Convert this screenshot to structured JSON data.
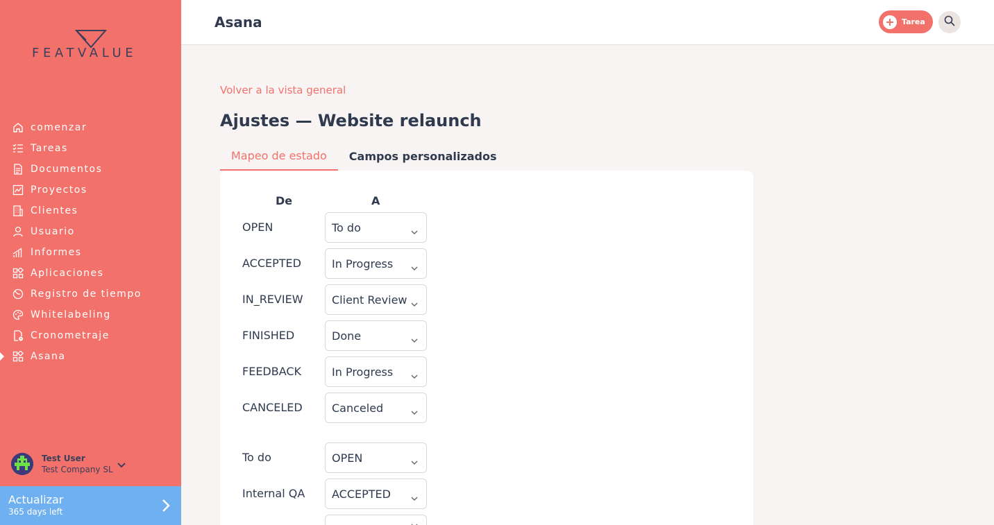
{
  "sidebar": {
    "logo_text": "FEATVALUE",
    "items": [
      {
        "label": "comenzar",
        "icon": "home-icon"
      },
      {
        "label": "Tareas",
        "icon": "checklist-icon"
      },
      {
        "label": "Documentos",
        "icon": "document-icon"
      },
      {
        "label": "Proyectos",
        "icon": "chart-icon"
      },
      {
        "label": "Clientes",
        "icon": "building-icon"
      },
      {
        "label": "Usuario",
        "icon": "user-icon"
      },
      {
        "label": "Informes",
        "icon": "signal-bars-icon"
      },
      {
        "label": "Aplicaciones",
        "icon": "apps-grid-icon"
      },
      {
        "label": "Registro de tiempo",
        "icon": "clock-icon"
      },
      {
        "label": "Whitelabeling",
        "icon": "palette-icon"
      },
      {
        "label": "Cronometraje",
        "icon": "timer-icon"
      },
      {
        "label": "Asana",
        "icon": "apps-grid-icon",
        "active": true
      }
    ],
    "user": {
      "name": "Test User",
      "company": "Test Company SL"
    },
    "upgrade": {
      "title": "Actualizar",
      "subtitle": "365 days left"
    }
  },
  "header": {
    "title": "Asana",
    "task_button": "Tarea"
  },
  "main": {
    "back_link": "Volver a la vista general",
    "page_title": "Ajustes — Website relaunch",
    "tabs": [
      {
        "label": "Mapeo de estado",
        "active": true
      },
      {
        "label": "Campos personalizados",
        "active": false
      }
    ],
    "columns": {
      "from": "De",
      "to": "A"
    },
    "mappings_out": [
      {
        "from": "OPEN",
        "to": "To do"
      },
      {
        "from": "ACCEPTED",
        "to": "In Progress"
      },
      {
        "from": "IN_REVIEW",
        "to": "Client Review"
      },
      {
        "from": "FINISHED",
        "to": "Done"
      },
      {
        "from": "FEEDBACK",
        "to": "In Progress"
      },
      {
        "from": "CANCELED",
        "to": "Canceled"
      }
    ],
    "mappings_in": [
      {
        "from": "To do",
        "to": "OPEN"
      },
      {
        "from": "Internal QA",
        "to": "ACCEPTED"
      },
      {
        "from": "",
        "to": ""
      }
    ]
  },
  "colors": {
    "brand": "#f2726b",
    "upgrade": "#6fb0f0",
    "text": "#2f3a4e"
  }
}
